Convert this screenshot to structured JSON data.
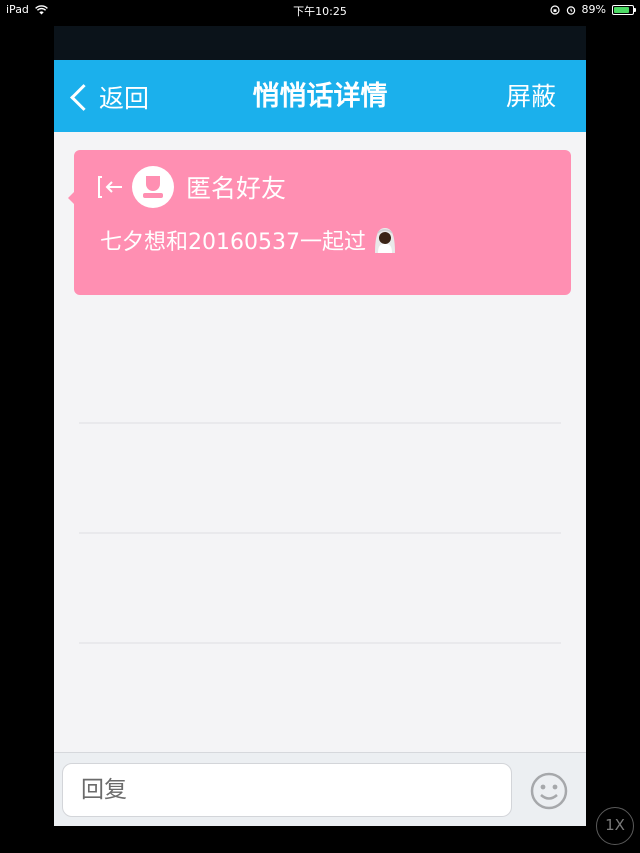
{
  "status_bar": {
    "device": "iPad",
    "time": "下午10:25",
    "battery_percent": "89%",
    "wifi_icon": "wifi-icon",
    "lock_icon": "orientation-lock-icon",
    "alarm_icon": "alarm-icon"
  },
  "nav": {
    "back_label": "返回",
    "title": "悄悄话详情",
    "right_label": "屏蔽"
  },
  "message": {
    "sender": "匿名好友",
    "text": "七夕想和20160537一起过",
    "emoji": "bride-with-veil-icon",
    "card_color": "#ff8fb2"
  },
  "reply": {
    "placeholder": "回复"
  },
  "zoom_badge": "1X",
  "colors": {
    "nav_bar": "#1bb0ec",
    "background": "#f4f4f6"
  }
}
